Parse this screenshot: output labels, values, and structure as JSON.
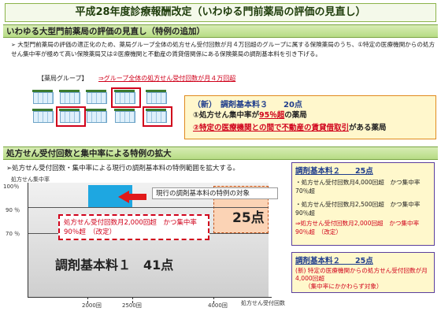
{
  "title": "平成28年度診療報酬改定（いわゆる門前薬局の評価の見直し）",
  "section1": {
    "heading": "いわゆる大型門前薬局の評価の見直し（特例の追加）",
    "bullet": "➢",
    "body": "大型門前薬局の評価の適正化のため、薬局グループ全体の処方せん受付回数が月４万回超のグループに属する保険薬局のうち、①特定の医療機関からの処方せん集中率が極めて高い保険薬局又は②医療機関と不動産の賃貸借関係にある保険薬局の調剤基本料を引き下げる。",
    "group_label": "【薬局グループ】",
    "group_note": "⇒グループ全体の処方せん受付回数が月４万回超",
    "new_box": {
      "header": "（新）　調剤基本料３　　20点",
      "item1_pre": "①処方せん集中率が",
      "item1_highlight": "95％超",
      "item1_post": "の薬局",
      "item2_highlight": "②特定の医療機関との間で不動産の賃貸借取引",
      "item2_post": "がある薬局"
    }
  },
  "section2": {
    "heading": "処方せん受付回数と集中率による特例の拡大",
    "intro": "➢処方せん受付回数・集中率による現行の調剤基本料の特例範囲を拡大する。",
    "y_axis_title": "処方せん集中率",
    "y_ticks": [
      "100％",
      "90 ％",
      "70 ％"
    ],
    "x_axis_title": "処方せん受付回数",
    "x_ticks": [
      "2000回",
      "2500回",
      "4000回"
    ],
    "arrow_label": "現行の調剤基本料の特例の対象",
    "score_25": "25点",
    "dashed_note": "処方せん受付回数月2,000回超　かつ集中率90％超　（改定）",
    "base_label": "調剤基本料１　41点",
    "box_a": {
      "header": "調剤基本料２　　25点",
      "line1": "・処方せん受付回数月4,000回超　かつ集中率70％超",
      "line2": "・処方せん受付回数月2,500回超　かつ集中率90％超",
      "line3": "⇒処方せん受付回数月2,000回超　かつ集中率90％超　（改定）"
    },
    "box_b": {
      "header": "調剤基本料２　　25点",
      "line1": "(新) 特定の医療機関からの処方せん受付回数が月4,000回超",
      "line2": "（集中率にかかわらず対象）"
    }
  },
  "colors": {
    "accent_green": "#b7dc85",
    "red": "#d0021b",
    "blue": "#1ea7e1",
    "orange": "#fbd3b5"
  }
}
